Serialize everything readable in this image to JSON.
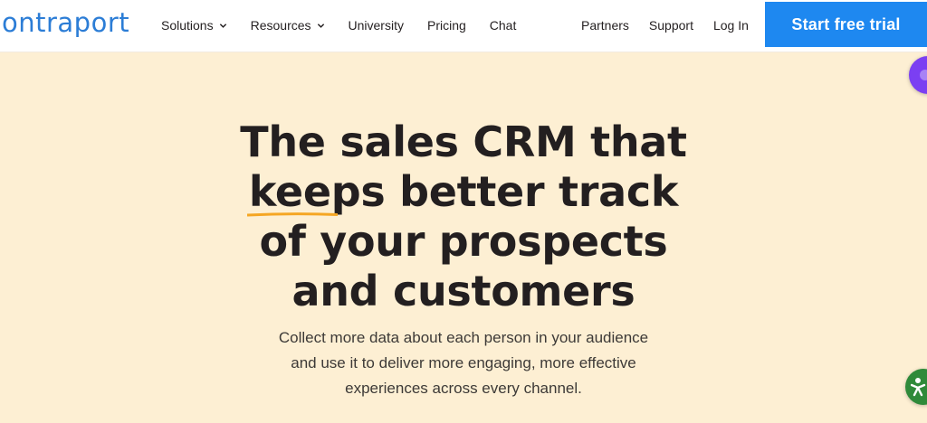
{
  "header": {
    "logo_text": "ontraport",
    "nav_left": [
      {
        "label": "Solutions",
        "has_dropdown": true
      },
      {
        "label": "Resources",
        "has_dropdown": true
      },
      {
        "label": "University",
        "has_dropdown": false
      },
      {
        "label": "Pricing",
        "has_dropdown": false
      },
      {
        "label": "Chat",
        "has_dropdown": false
      }
    ],
    "nav_right": [
      {
        "label": "Partners"
      },
      {
        "label": "Support"
      },
      {
        "label": "Log In"
      }
    ],
    "cta_label": "Start free trial"
  },
  "hero": {
    "title_line1": "The sales CRM that",
    "title_line2": "keeps better track",
    "title_line3": "of your prospects",
    "title_line4": "and customers",
    "subtitle": "Collect more data about each person in your audience and use it to deliver more engaging, more effective experiences across every channel."
  },
  "colors": {
    "brand_blue": "#2c7dd6",
    "cta_blue": "#1e88f0",
    "hero_background": "#fdefd3",
    "highlight_underline": "#f5a623",
    "chat_widget": "#7b3ff2",
    "accessibility_widget": "#2f8a3a"
  },
  "icons": {
    "dropdown": "chevron-down-icon",
    "chat_widget": "chat-bubble-icon",
    "accessibility_widget": "accessibility-icon"
  }
}
